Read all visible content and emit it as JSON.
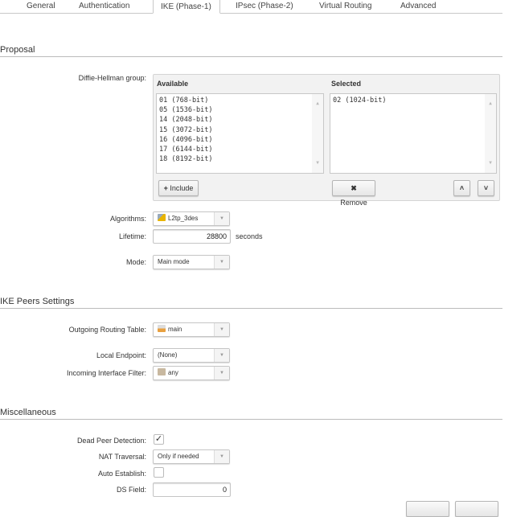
{
  "tabs": [
    {
      "label": "General"
    },
    {
      "label": "Authentication"
    },
    {
      "label": "IKE (Phase-1)",
      "active": true
    },
    {
      "label": "IPsec (Phase-2)"
    },
    {
      "label": "Virtual Routing"
    },
    {
      "label": "Advanced"
    }
  ],
  "proposal": {
    "title": "Proposal",
    "dh_label": "Diffie-Hellman group:",
    "available_header": "Available",
    "selected_header": "Selected",
    "available": [
      "01 (768-bit)",
      "05 (1536-bit)",
      "14 (2048-bit)",
      "15 (3072-bit)",
      "16 (4096-bit)",
      "17 (6144-bit)",
      "18 (8192-bit)"
    ],
    "selected": [
      "02 (1024-bit)"
    ],
    "include_label": "Include",
    "remove_label": "Remove",
    "algorithms_label": "Algorithms:",
    "algorithms_value": "L2tp_3des",
    "lifetime_label": "Lifetime:",
    "lifetime_value": "28800",
    "lifetime_unit": "seconds",
    "mode_label": "Mode:",
    "mode_value": "Main mode"
  },
  "peers": {
    "title": "IKE Peers Settings",
    "routing_label": "Outgoing Routing Table:",
    "routing_value": "main",
    "endpoint_label": "Local Endpoint:",
    "endpoint_value": "(None)",
    "filter_label": "Incoming Interface Filter:",
    "filter_value": "any"
  },
  "misc": {
    "title": "Miscellaneous",
    "dpd_label": "Dead Peer Detection:",
    "dpd_checked": true,
    "nat_label": "NAT Traversal:",
    "nat_value": "Only if needed",
    "auto_label": "Auto Establish:",
    "auto_checked": false,
    "ds_label": "DS Field:",
    "ds_value": "0"
  }
}
